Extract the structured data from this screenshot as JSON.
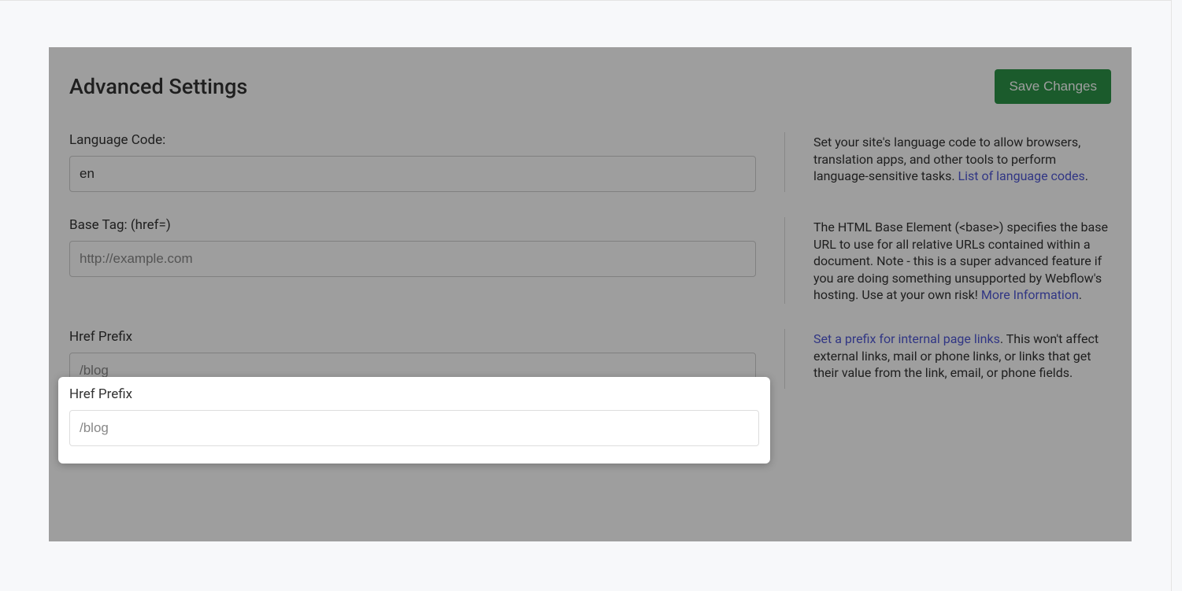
{
  "header": {
    "title": "Advanced Settings",
    "save_label": "Save Changes"
  },
  "language": {
    "label": "Language Code:",
    "value": "en",
    "help_pre": "Set your site's language code to allow browsers, translation apps, and other tools to perform language-sensitive tasks. ",
    "link_text": "List of language codes",
    "help_post": "."
  },
  "base_tag": {
    "label": "Base Tag: (href=)",
    "placeholder": "http://example.com",
    "value": "",
    "help_pre": "The HTML Base Element (<base>) specifies the base URL to use for all relative URLs contained within a document. Note - this is a super advanced feature if you are doing something unsupported by Webflow's hosting. Use at your own risk! ",
    "link_text": "More Information",
    "help_post": "."
  },
  "href_prefix": {
    "label": "Href Prefix",
    "placeholder": "/blog",
    "value": "",
    "link_text": "Set a prefix for internal page links",
    "help_post": ". This won't affect external links, mail or phone links, or links that get their value from the link, email, or phone fields."
  }
}
